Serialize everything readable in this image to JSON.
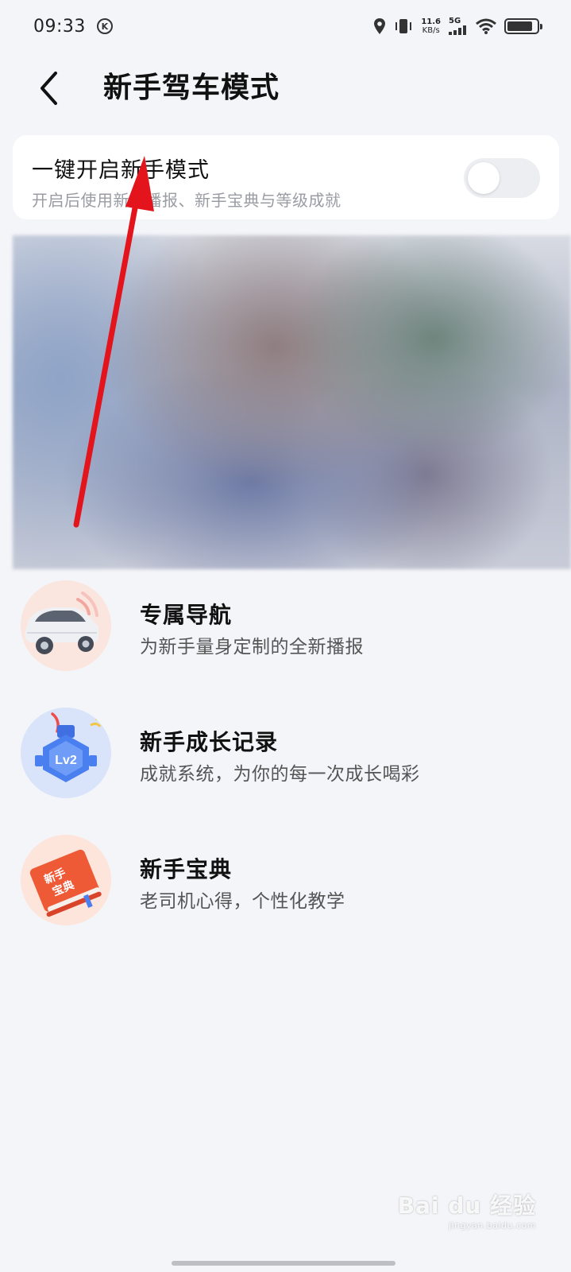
{
  "status_bar": {
    "time": "09:33",
    "k_badge": "K",
    "net_speed_value": "11.6",
    "net_speed_unit": "KB/s",
    "network_type": "5G"
  },
  "header": {
    "title": "新手驾车模式",
    "back_icon": "chevron-left-icon"
  },
  "toggle_card": {
    "title": "一键开启新手模式",
    "subtitle": "开启后使用新手播报、新手宝典与等级成就",
    "enabled": false
  },
  "features": [
    {
      "title": "专属导航",
      "description": "为新手量身定制的全新播报",
      "icon": "car-icon"
    },
    {
      "title": "新手成长记录",
      "description": "成就系统，为你的每一次成长喝彩",
      "icon": "level-badge-icon",
      "badge_text": "Lv2"
    },
    {
      "title": "新手宝典",
      "description": "老司机心得，个性化教学",
      "icon": "guide-book-icon",
      "book_text": "新手宝典"
    }
  ],
  "watermark": {
    "main": "Bai du 经验",
    "sub": "jingyan.baidu.com"
  },
  "annotation": {
    "color": "#e3141b"
  }
}
